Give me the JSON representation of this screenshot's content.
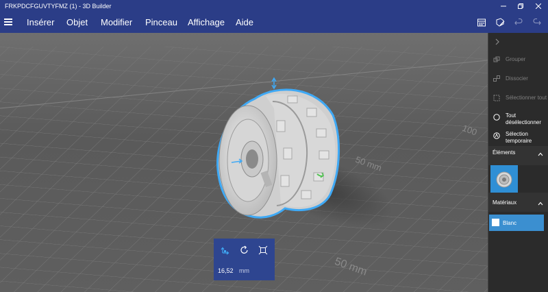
{
  "window": {
    "title": "FRKPDCFGUVTYFMZ (1) - 3D Builder"
  },
  "menu": {
    "items": [
      "Insérer",
      "Objet",
      "Modifier",
      "Pinceau",
      "Affichage",
      "Aide"
    ]
  },
  "viewport": {
    "grid_labels": [
      "100",
      "50 mm",
      "50 mm"
    ]
  },
  "scale_panel": {
    "value": "16,52",
    "unit": "mm"
  },
  "sidebar": {
    "actions": [
      {
        "label": "Grouper",
        "enabled": false
      },
      {
        "label": "Dissocier",
        "enabled": false
      },
      {
        "label": "Sélectionner tout",
        "enabled": false
      },
      {
        "label": "Tout désélectionner",
        "enabled": true
      },
      {
        "label": "Sélection temporaire",
        "enabled": true
      }
    ],
    "elements_title": "Éléments",
    "materials_title": "Matériaux",
    "material_name": "Blanc"
  },
  "colors": {
    "chrome": "#2b3d87",
    "accent": "#3b8fd0",
    "selection_outline": "#3fa9f5",
    "sidebar_bg": "#2b2b2b"
  }
}
